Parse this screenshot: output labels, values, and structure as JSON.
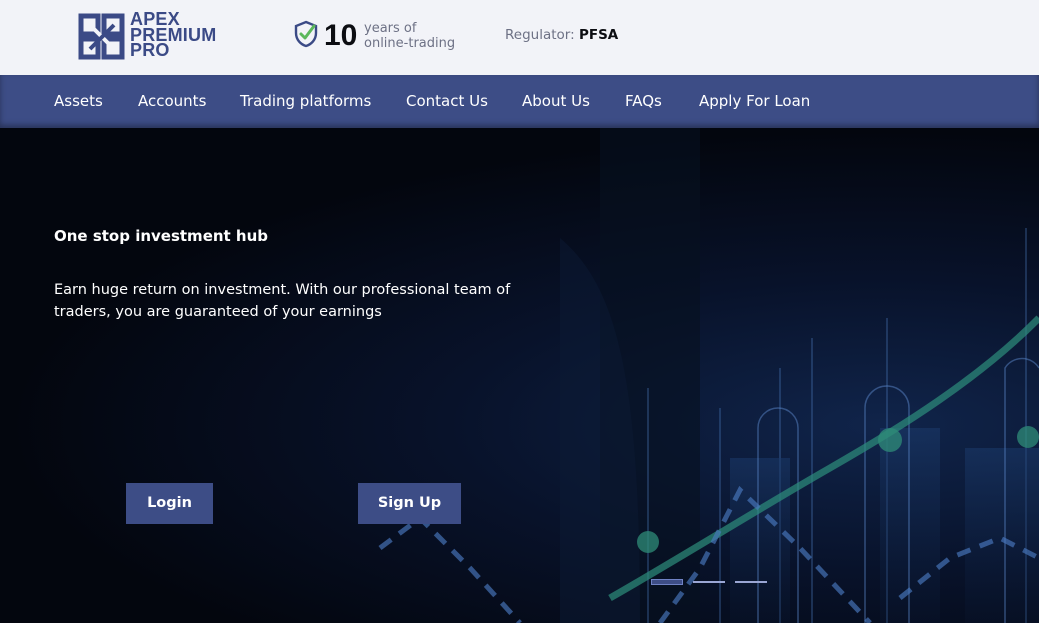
{
  "brand": {
    "logo_lines": [
      "APEX",
      "PREMIUM",
      "PRO"
    ],
    "logo_icon": "apex-logo-mark",
    "color": "#3b4a86"
  },
  "trust": {
    "icon": "shield-check-icon",
    "years_number": "10",
    "years_line1": "years of",
    "years_line2": "online-trading"
  },
  "regulator": {
    "label": "Regulator:",
    "value": "PFSA"
  },
  "nav": {
    "items": [
      {
        "label": "Assets"
      },
      {
        "label": "Accounts"
      },
      {
        "label": "Trading platforms"
      },
      {
        "label": "Contact Us"
      },
      {
        "label": "About Us"
      },
      {
        "label": "FAQs"
      },
      {
        "label": "Apply For Loan"
      }
    ]
  },
  "hero": {
    "title": "One stop investment hub",
    "text": "Earn huge return on investment. With our professional team of traders, you are guaranteed of your earnings",
    "login_label": "Login",
    "signup_label": "Sign Up",
    "slides_total": 3,
    "slide_active": 1
  },
  "colors": {
    "accent": "#3d4d86",
    "header_bg": "#f2f3f8",
    "hero_bg": "#03060e",
    "check_green": "#5cb85c"
  }
}
